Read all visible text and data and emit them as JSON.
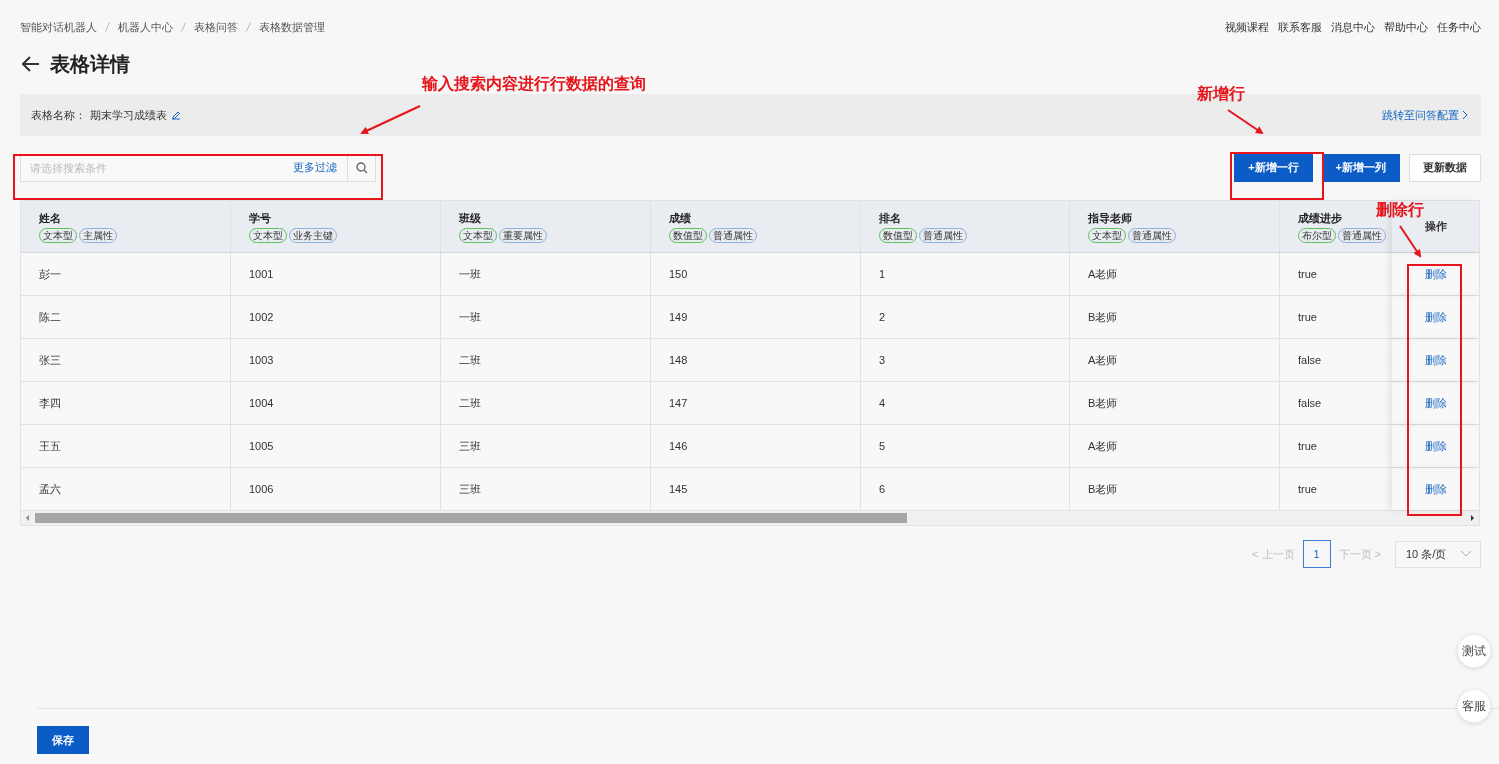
{
  "breadcrumb": [
    "智能对话机器人",
    "机器人中心",
    "表格问答",
    "表格数据管理"
  ],
  "top_links": [
    "视频课程",
    "联系客服",
    "消息中心",
    "帮助中心",
    "任务中心"
  ],
  "title": "表格详情",
  "info_bar": {
    "label": "表格名称：",
    "value": "期末学习成绩表",
    "link": "跳转至问答配置"
  },
  "search": {
    "placeholder": "请选择搜索条件",
    "filter_link": "更多过滤"
  },
  "buttons": [
    {
      "label": "+新增一行",
      "kind": "primary"
    },
    {
      "label": "+新增一列",
      "kind": "primary"
    },
    {
      "label": "更新数据",
      "kind": "default"
    }
  ],
  "table": {
    "columns": [
      {
        "name": "姓名",
        "tags": [
          {
            "label": "文本型",
            "kind": "type"
          },
          {
            "label": "主属性",
            "kind": "attribute"
          }
        ]
      },
      {
        "name": "学号",
        "tags": [
          {
            "label": "文本型",
            "kind": "type"
          },
          {
            "label": "业务主键",
            "kind": "attribute"
          }
        ]
      },
      {
        "name": "班级",
        "tags": [
          {
            "label": "文本型",
            "kind": "type"
          },
          {
            "label": "重要属性",
            "kind": "attribute"
          }
        ]
      },
      {
        "name": "成绩",
        "tags": [
          {
            "label": "数值型",
            "kind": "type"
          },
          {
            "label": "普通属性",
            "kind": "attribute"
          }
        ]
      },
      {
        "name": "排名",
        "tags": [
          {
            "label": "数值型",
            "kind": "type"
          },
          {
            "label": "普通属性",
            "kind": "attribute"
          }
        ]
      },
      {
        "name": "指导老师",
        "tags": [
          {
            "label": "文本型",
            "kind": "type"
          },
          {
            "label": "普通属性",
            "kind": "attribute"
          }
        ]
      },
      {
        "name": "成绩进步",
        "tags": [
          {
            "label": "布尔型",
            "kind": "type"
          },
          {
            "label": "普通属性",
            "kind": "attribute"
          }
        ]
      }
    ],
    "action_column": "操作",
    "rows": [
      {
        "cells": [
          "彭一",
          "1001",
          "一班",
          "150",
          "1",
          "A老师",
          "true"
        ],
        "action": "删除"
      },
      {
        "cells": [
          "陈二",
          "1002",
          "一班",
          "149",
          "2",
          "B老师",
          "true"
        ],
        "action": "删除"
      },
      {
        "cells": [
          "张三",
          "1003",
          "二班",
          "148",
          "3",
          "A老师",
          "false"
        ],
        "action": "删除"
      },
      {
        "cells": [
          "李四",
          "1004",
          "二班",
          "147",
          "4",
          "B老师",
          "false"
        ],
        "action": "删除"
      },
      {
        "cells": [
          "王五",
          "1005",
          "三班",
          "146",
          "5",
          "A老师",
          "true"
        ],
        "action": "删除"
      },
      {
        "cells": [
          "孟六",
          "1006",
          "三班",
          "145",
          "6",
          "B老师",
          "true"
        ],
        "action": "删除"
      }
    ]
  },
  "pagination": {
    "prev": {
      "label": "< 上一页",
      "disabled": true
    },
    "pages": [
      {
        "label": "1",
        "selected": true
      }
    ],
    "next": {
      "label": "下一页 >",
      "disabled": true
    },
    "page_size": "10 条/页"
  },
  "float_buttons": [
    "测试",
    "客服"
  ],
  "save_button": "保存",
  "annotations": [
    "输入搜索内容进行行数据的查询",
    "新增行",
    "删除行"
  ]
}
